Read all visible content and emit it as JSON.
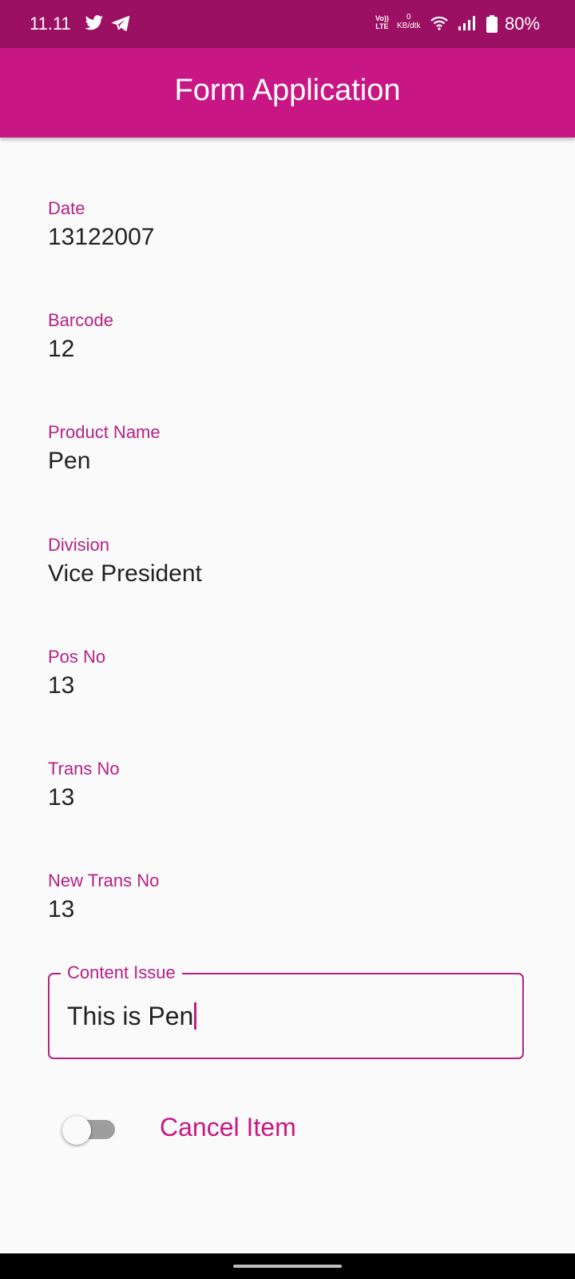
{
  "status_bar": {
    "time": "11.11",
    "volte_line1": "Vo))",
    "volte_line2": "LTE",
    "net_speed_value": "0",
    "net_speed_unit": "KB/dtk",
    "battery": "80%",
    "icons": [
      "twitter-icon",
      "telegram-icon",
      "wifi-icon",
      "signal-icon",
      "battery-icon"
    ]
  },
  "app_bar": {
    "title": "Form Application"
  },
  "fields": {
    "date": {
      "label": "Date",
      "value": "13122007"
    },
    "barcode": {
      "label": "Barcode",
      "value": "12"
    },
    "product_name": {
      "label": "Product Name",
      "value": "Pen"
    },
    "division": {
      "label": "Division",
      "value": "Vice President"
    },
    "pos_no": {
      "label": "Pos No",
      "value": "13"
    },
    "trans_no": {
      "label": "Trans No",
      "value": "13"
    },
    "new_trans_no": {
      "label": "New Trans No",
      "value": "13"
    }
  },
  "content_issue": {
    "label": "Content Issue",
    "value": "This is Pen"
  },
  "cancel_item": {
    "label": "Cancel Item",
    "checked": false
  },
  "colors": {
    "status_bar": "#9c1063",
    "app_bar": "#c81785",
    "accent_label": "#b52286",
    "background": "#fafafa"
  }
}
